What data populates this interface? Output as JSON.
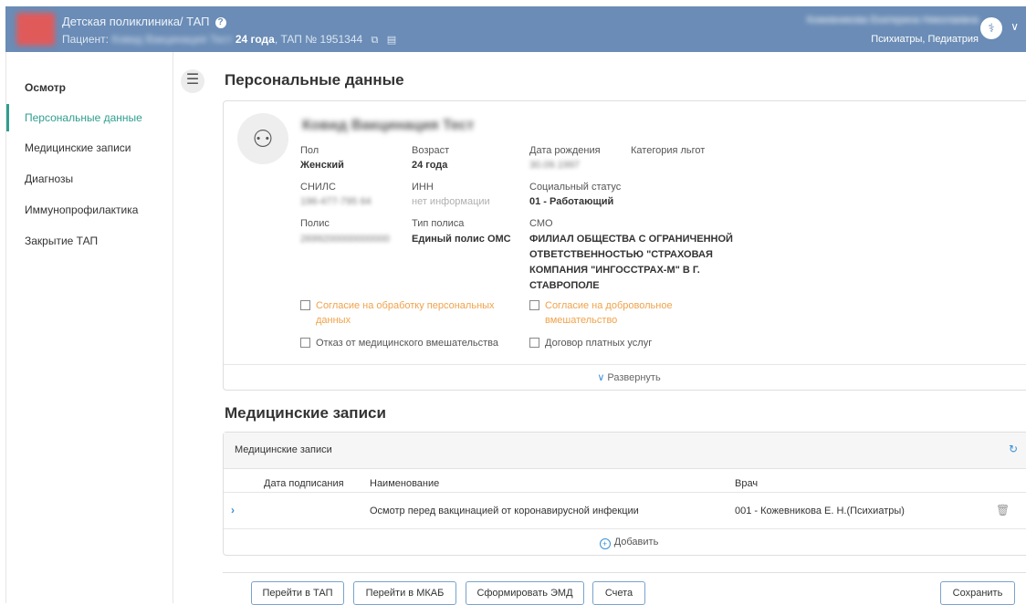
{
  "header": {
    "title": "Детская поликлиника/ ТАП",
    "help_icon": "?",
    "patient_label": "Пациент:",
    "patient_name": "Ковид Вакцинация Тест",
    "patient_age": "24 года",
    "tap_number": ", ТАП № 1951344",
    "user_name": "Кожевникова Екатерина Николаевна",
    "user_role": "Психиатры, Педиатрия",
    "colors": {
      "bar": "#6a8cb6"
    }
  },
  "sidebar": {
    "items": [
      {
        "label": "Осмотр"
      },
      {
        "label": "Персональные данные"
      },
      {
        "label": "Медицинские записи"
      },
      {
        "label": "Диагнозы"
      },
      {
        "label": "Иммунопрофилактика"
      },
      {
        "label": "Закрытие ТАП"
      }
    ]
  },
  "personal": {
    "title": "Персональные данные",
    "full_name": "Ковид Вакцинация Тест",
    "fields": {
      "gender_label": "Пол",
      "gender": "Женский",
      "age_label": "Возраст",
      "age": "24 года",
      "dob_label": "Дата рождения",
      "dob": "30.09.1997",
      "benefit_label": "Категория льгот",
      "snils_label": "СНИЛС",
      "snils": "196-477-795 64",
      "inn_label": "ИНН",
      "inn": "нет информации",
      "social_label": "Социальный статус",
      "social": "01 - Работающий",
      "policy_label": "Полис",
      "policy": "2699200000000000",
      "policy_type_label": "Тип полиса",
      "policy_type": "Единый полис ОМС",
      "smo_label": "СМО",
      "smo": "ФИЛИАЛ ОБЩЕСТВА С ОГРАНИЧЕННОЙ ОТВЕТСТВЕННОСТЬЮ \"СТРАХОВАЯ КОМПАНИЯ \"ИНГОССТРАХ-М\" В Г. СТАВРОПОЛЕ"
    },
    "checkboxes": {
      "consent_personal": "Согласие на обработку персональных данных",
      "consent_voluntary": "Согласие на добровольное вмешательство",
      "refusal": "Отказ от медицинского вмешательства",
      "paid_contract": "Договор платных услуг"
    },
    "expand_label": "Развернуть"
  },
  "records": {
    "title": "Медицинские записи",
    "panel_title": "Медицинские записи",
    "columns": [
      "Дата подписания",
      "Наименование",
      "Врач"
    ],
    "rows": [
      {
        "date": "",
        "name": "Осмотр перед вакцинацией от коронавирусной инфекции",
        "doctor": "001 - Кожевникова Е. Н.(Психиатры)"
      }
    ],
    "add_label": "Добавить"
  },
  "footer": {
    "buttons": [
      "Перейти в ТАП",
      "Перейти в МКАБ",
      "Сформировать ЭМД",
      "Счета"
    ],
    "save": "Сохранить"
  }
}
